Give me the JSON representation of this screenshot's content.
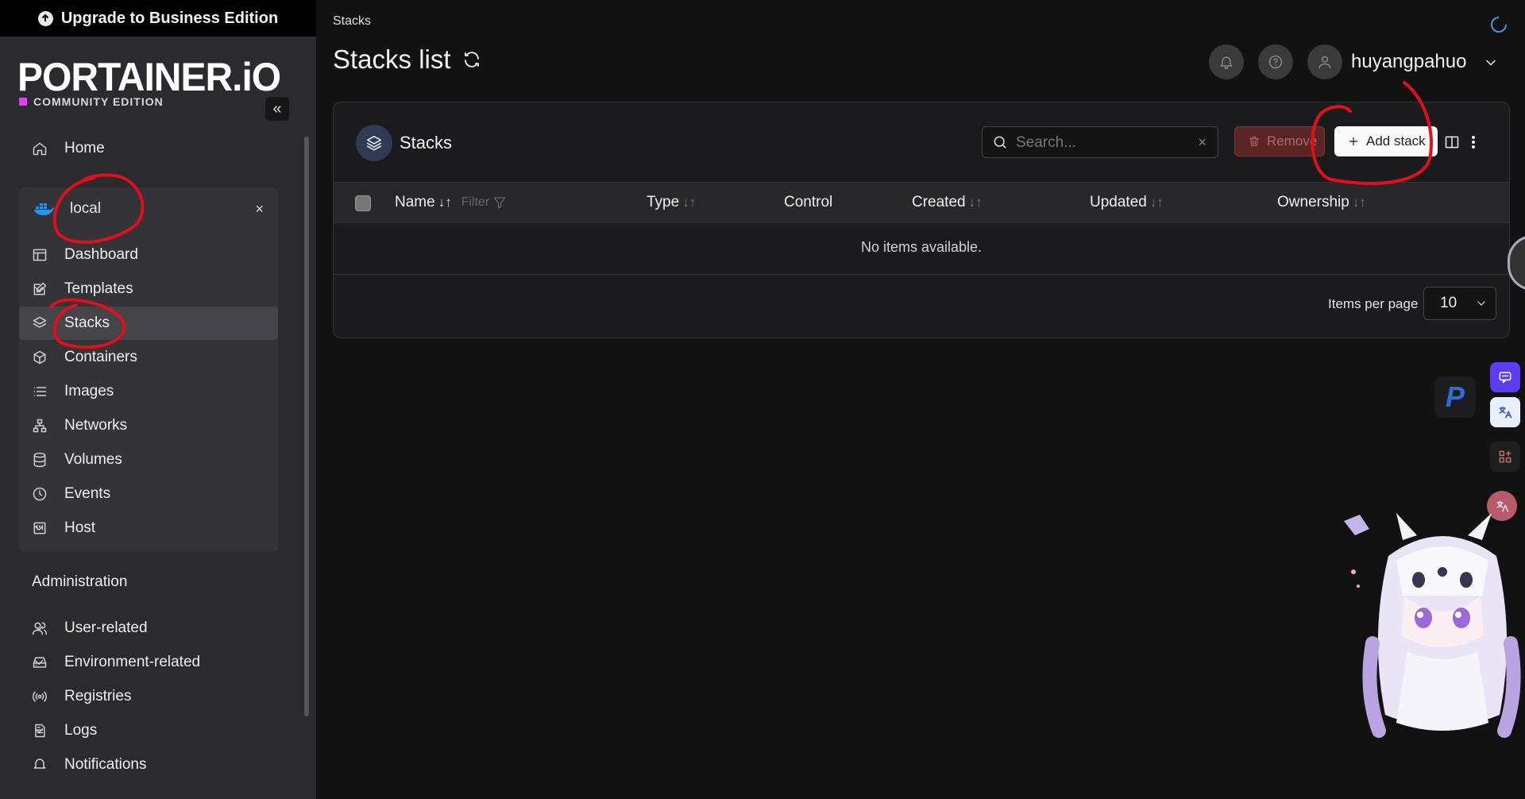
{
  "sidebar": {
    "upgrade_label": "Upgrade to Business Edition",
    "logo": "PORTAINER.iO",
    "edition": "COMMUNITY EDITION",
    "collapse_glyph": "«",
    "home_label": "Home",
    "environment": {
      "name": "local",
      "close_glyph": "×",
      "items": [
        {
          "label": "Dashboard"
        },
        {
          "label": "Templates"
        },
        {
          "label": "Stacks"
        },
        {
          "label": "Containers"
        },
        {
          "label": "Images"
        },
        {
          "label": "Networks"
        },
        {
          "label": "Volumes"
        },
        {
          "label": "Events"
        },
        {
          "label": "Host"
        }
      ]
    },
    "admin_title": "Administration",
    "admin_items": [
      {
        "label": "User-related"
      },
      {
        "label": "Environment-related"
      },
      {
        "label": "Registries"
      },
      {
        "label": "Logs"
      },
      {
        "label": "Notifications"
      }
    ]
  },
  "header": {
    "breadcrumb": "Stacks",
    "title": "Stacks list",
    "username": "huyangpahuo"
  },
  "panel": {
    "title": "Stacks",
    "search_placeholder": "Search...",
    "clear_glyph": "×",
    "remove_label": "Remove",
    "add_label": "Add stack",
    "columns": {
      "name": "Name",
      "filter": "Filter",
      "type": "Type",
      "control": "Control",
      "created": "Created",
      "updated": "Updated",
      "ownership": "Ownership"
    },
    "sort_glyph": "↓↑",
    "empty_text": "No items available.",
    "items_per_page_label": "Items per page",
    "items_per_page_value": "10"
  },
  "colors": {
    "accent_pink": "#e040fb",
    "danger": "#5b2525",
    "annotation_red": "#e0101a"
  }
}
